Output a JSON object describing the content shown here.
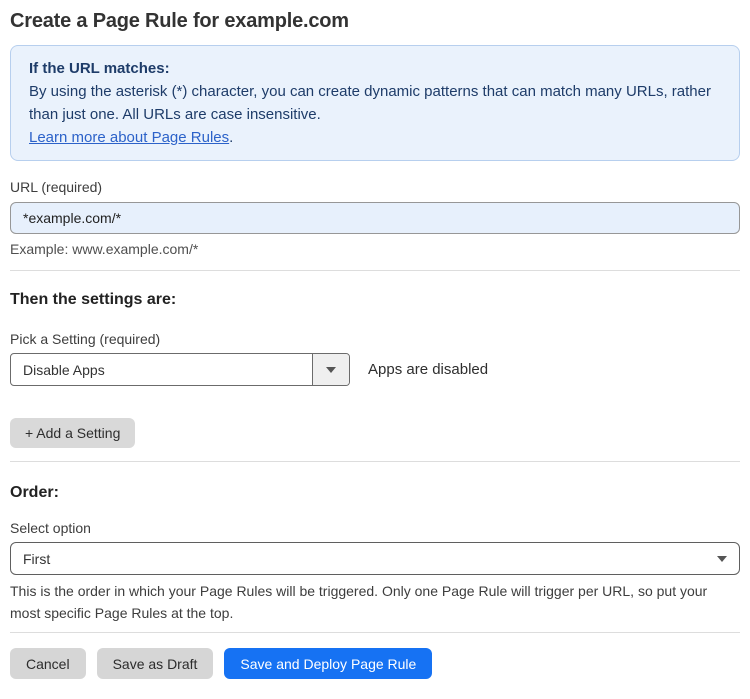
{
  "page": {
    "title": "Create a Page Rule for example.com"
  },
  "info_box": {
    "heading": "If the URL matches:",
    "body": "By using the asterisk (*) character, you can create dynamic patterns that can match many URLs, rather than just one. All URLs are case insensitive.",
    "link_label": "Learn more about Page Rules",
    "link_suffix": "."
  },
  "url_field": {
    "label": "URL (required)",
    "value": "*example.com/*",
    "helper": "Example: www.example.com/*"
  },
  "settings_section": {
    "heading": "Then the settings are:",
    "picker_label": "Pick a Setting (required)",
    "selected_setting": "Disable Apps",
    "setting_status": "Apps are disabled",
    "add_setting_label": "+ Add a Setting"
  },
  "order_section": {
    "heading": "Order:",
    "select_label": "Select option",
    "selected_option": "First",
    "helper": "This is the order in which your Page Rules will be triggered. Only one Page Rule will trigger per URL, so put your most specific Page Rules at the top."
  },
  "footer": {
    "cancel_label": "Cancel",
    "save_draft_label": "Save as Draft",
    "save_deploy_label": "Save and Deploy Page Rule"
  },
  "icons": {
    "setting_dropdown": "caret-down-icon",
    "order_dropdown": "caret-down-icon"
  },
  "colors": {
    "accent_blue": "#1672f3",
    "info_box_bg": "#eaf2fc",
    "info_box_border": "#b7cfee",
    "info_text_navy": "#1e3c69",
    "link_blue": "#2c62c9",
    "url_input_bg": "#e7f0fc",
    "button_gray": "#d6d6d6"
  }
}
